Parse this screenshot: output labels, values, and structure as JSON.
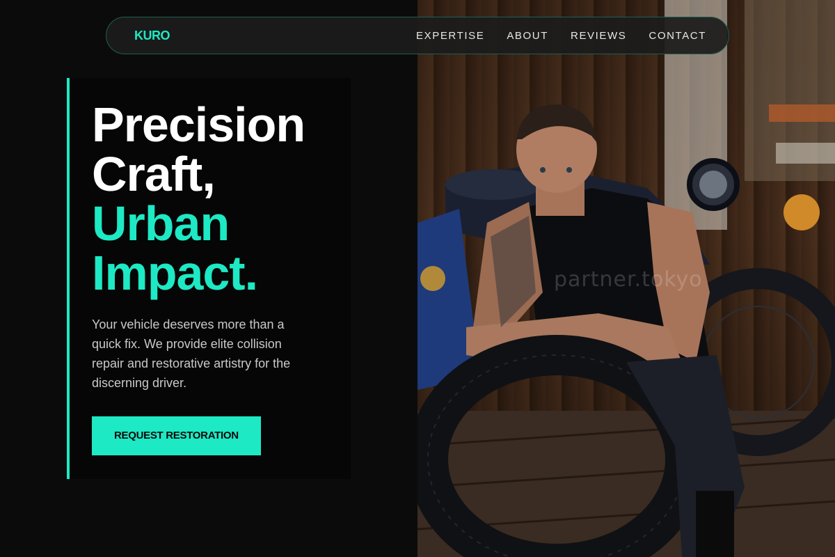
{
  "brand": {
    "logo": "KURO",
    "accent": "#1de9c4"
  },
  "nav": {
    "links": [
      {
        "label": "EXPERTISE"
      },
      {
        "label": "ABOUT"
      },
      {
        "label": "REVIEWS"
      },
      {
        "label": "CONTACT"
      }
    ]
  },
  "hero": {
    "headline": [
      "Precision",
      "Craft,",
      "Urban",
      "Impact."
    ],
    "lede": "Your vehicle deserves more than a quick fix. We provide elite collision repair and restorative artistry for the discerning driver.",
    "cta_label": "REQUEST RESTORATION"
  },
  "photo": {
    "subject": "Tattooed man leaning on a motorcycle tire in a garage",
    "watermark": "partner.tokyo"
  }
}
